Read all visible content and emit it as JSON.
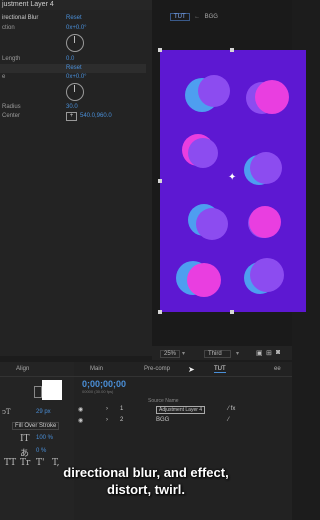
{
  "effect_controls": {
    "layer_title": "justment Layer 4",
    "fx_name": "irectional Blur",
    "fx_reset": "Reset",
    "direction_label": "ction",
    "direction_value": "0x+0.0°",
    "length_label": "Length",
    "length_value": "0.0",
    "reset2": "Reset",
    "angle_label": "e",
    "angle_value": "0x+0.0°",
    "radius_label": "Radius",
    "radius_value": "30.0",
    "center_label": "Center",
    "center_value": "540.0,960.0"
  },
  "viewer": {
    "tab1": "TUT",
    "tab2": "BGG",
    "zoom": "25%",
    "resolution": "Third",
    "canvas_color": "#5d18d2"
  },
  "left_panel": {
    "tab_align": "Align",
    "font_size": "29 px",
    "fill_over_stroke": "Fill Over Stroke",
    "scale_value": "100 %",
    "tsume_value": "0 %",
    "type_buttons": [
      "TT",
      "Tr",
      "T'",
      "T,"
    ]
  },
  "timeline": {
    "tabs": [
      "Main",
      "Pre-comp",
      "TUT",
      "ee"
    ],
    "timecode": "0;00;00;00",
    "timecode_sub": "00000 (30.00 fps)",
    "col_source": "Source Name",
    "layers": [
      {
        "num": "1",
        "name": "Adjustment Layer 4"
      },
      {
        "num": "2",
        "name": "BGG"
      }
    ]
  },
  "subtitle": {
    "line1": "directional blur, and effect,",
    "line2": "distort, twirl."
  },
  "colors": {
    "accent": "#4a8fd8",
    "canvas": "#5d18d2",
    "dot_blue": "#4e9ef0",
    "dot_pink": "#e93ee0",
    "dot_violet": "#8c4cf0"
  }
}
